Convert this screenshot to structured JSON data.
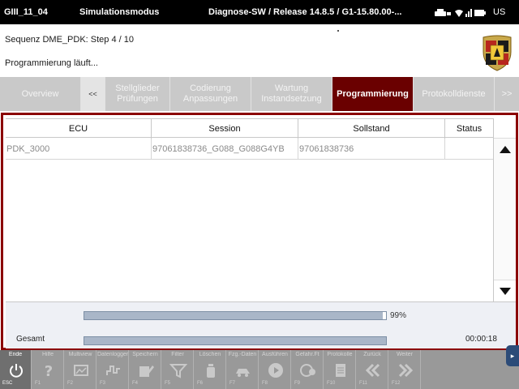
{
  "topbar": {
    "device_id": "GIII_11_04",
    "mode": "Simulationsmodus",
    "software": "Diagnose-SW / Release 14.8.5 / G1-15.80.00-...",
    "language": "US"
  },
  "info": {
    "sequence": "Sequenz DME_PDK: Step 4 / 10",
    "status": "Programmierung läuft..."
  },
  "tabs": [
    {
      "label": "Overview"
    },
    {
      "label": "<<"
    },
    {
      "label": "Stellglieder\nPrüfungen"
    },
    {
      "label": "Codierung\nAnpassungen"
    },
    {
      "label": "Wartung\nInstandsetzung"
    },
    {
      "label": "Programmierung"
    },
    {
      "label": "Protokolldienste"
    },
    {
      "label": ">>"
    }
  ],
  "table": {
    "columns": [
      "ECU",
      "Session",
      "Sollstand",
      "Status"
    ],
    "rows": [
      {
        "ecu": "PDK_3000",
        "session": "97061838736_G088_G088G4YB",
        "sollstand": "97061838736",
        "status": ""
      }
    ]
  },
  "progress": {
    "step_percent_label": "99%",
    "step_fraction": 0.99,
    "total_label": "Gesamt",
    "total_fraction": 1.0,
    "elapsed": "00:00:18"
  },
  "toolbar": {
    "keys": [
      {
        "label": "Ende",
        "fn": "ESC",
        "icon": "power-icon"
      },
      {
        "label": "Hilfe",
        "fn": "F1",
        "icon": "help-icon"
      },
      {
        "label": "Multiview",
        "fn": "F2",
        "icon": "multiview-icon"
      },
      {
        "label": "Datenlogger",
        "fn": "F3",
        "icon": "chart-icon"
      },
      {
        "label": "Speichern",
        "fn": "F4",
        "icon": "save-edit-icon"
      },
      {
        "label": "Filter",
        "fn": "F5",
        "icon": "filter-icon"
      },
      {
        "label": "Löschen",
        "fn": "F6",
        "icon": "trash-icon"
      },
      {
        "label": "Fzg.-Daten",
        "fn": "F7",
        "icon": "vehicle-data-icon"
      },
      {
        "label": "Ausführen",
        "fn": "F8",
        "icon": "play-icon"
      },
      {
        "label": "Gefahr.Ft",
        "fn": "F9",
        "icon": "hazard-icon"
      },
      {
        "label": "Protokolle",
        "fn": "F10",
        "icon": "document-icon"
      },
      {
        "label": "Zurück",
        "fn": "F11",
        "icon": "back-icon"
      },
      {
        "label": "Weiter",
        "fn": "F12",
        "icon": "forward-icon"
      }
    ]
  }
}
